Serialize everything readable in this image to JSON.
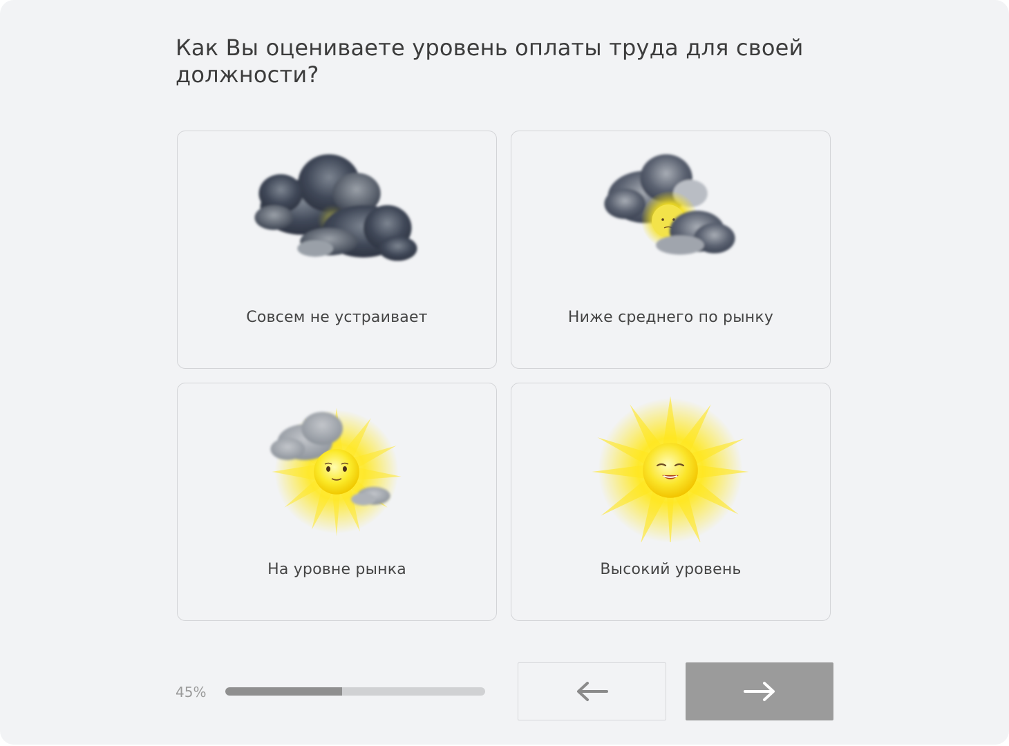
{
  "question": {
    "text": "Как Вы оцениваете уровень оплаты труда для своей должности?"
  },
  "options": [
    {
      "label": "Совсем не устраивает",
      "icon": "storm-clouds-icon"
    },
    {
      "label": "Ниже среднего по рынку",
      "icon": "sun-behind-clouds-icon"
    },
    {
      "label": "На уровне рынка",
      "icon": "sun-with-small-cloud-icon"
    },
    {
      "label": "Высокий уровень",
      "icon": "happy-sun-icon"
    }
  ],
  "progress": {
    "label": "45%",
    "fraction": 0.45
  },
  "navigation": {
    "back_icon": "arrow-left-icon",
    "next_icon": "arrow-right-icon"
  },
  "colors": {
    "background": "#f2f3f5",
    "card_border": "#d3d4d7",
    "progress_fill": "#8f8f8f",
    "progress_track": "#d0d1d3",
    "next_button": "#9b9b9b",
    "sun_yellow": "#ffe21a",
    "cloud_dark": "#3a4150"
  }
}
